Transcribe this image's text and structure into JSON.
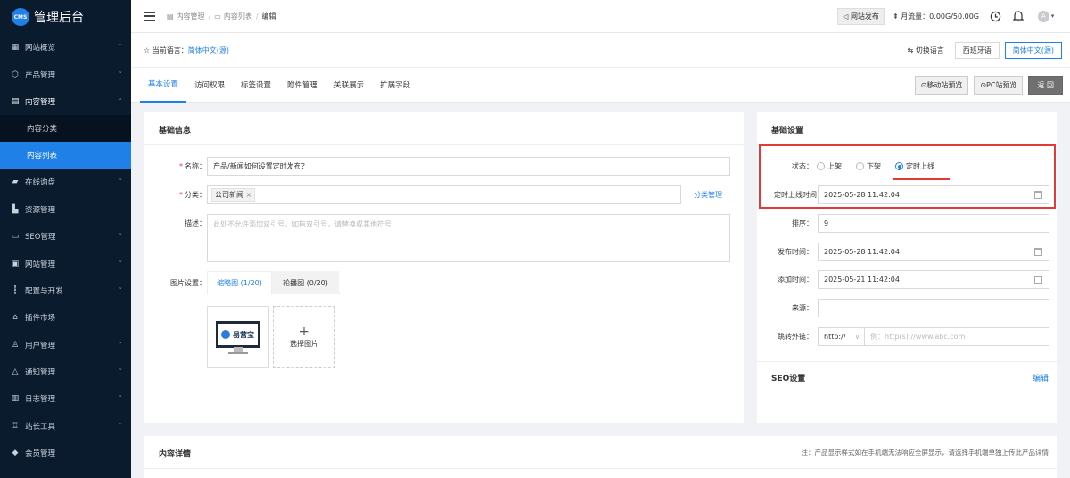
{
  "app": {
    "logo_badge": "CMS",
    "title": "管理后台"
  },
  "sidebar": {
    "items": [
      {
        "label": "网站概览",
        "icon": "dashboard-icon",
        "has_arrow": true
      },
      {
        "label": "产品管理",
        "icon": "box-icon",
        "has_arrow": true
      },
      {
        "label": "内容管理",
        "icon": "document-icon",
        "has_arrow": true,
        "open": true
      },
      {
        "label": "在线询盘",
        "icon": "chat-icon",
        "has_arrow": true
      },
      {
        "label": "资源管理",
        "icon": "folder-icon",
        "has_arrow": false
      },
      {
        "label": "SEO管理",
        "icon": "monitor-icon",
        "has_arrow": true
      },
      {
        "label": "网站管理",
        "icon": "site-icon",
        "has_arrow": true
      },
      {
        "label": "配置与开发",
        "icon": "sliders-icon",
        "has_arrow": true
      },
      {
        "label": "插件市场",
        "icon": "plugin-icon",
        "has_arrow": false
      },
      {
        "label": "用户管理",
        "icon": "user-icon",
        "has_arrow": true
      },
      {
        "label": "通知管理",
        "icon": "bell-icon",
        "has_arrow": true
      },
      {
        "label": "日志管理",
        "icon": "log-icon",
        "has_arrow": true
      },
      {
        "label": "站长工具",
        "icon": "tools-icon",
        "has_arrow": true
      },
      {
        "label": "会员管理",
        "icon": "member-icon",
        "has_arrow": false
      }
    ],
    "sub_items": [
      {
        "label": "内容分类",
        "active": false
      },
      {
        "label": "内容列表",
        "active": true
      }
    ]
  },
  "topbar": {
    "breadcrumb": [
      "内容管理",
      "内容列表",
      "编辑"
    ],
    "publish_label": "网站发布",
    "flow_label": "月流量：0.00G/50.00G",
    "avatar_letter": "A"
  },
  "lang_bar": {
    "current_label": "当前语言：",
    "current_value": "简体中文(源)",
    "switch_label": "切换语言",
    "languages": [
      "西班牙语",
      "简体中文(源)"
    ]
  },
  "tabs": [
    "基本设置",
    "访问权限",
    "标签设置",
    "附件管理",
    "关联展示",
    "扩展字段"
  ],
  "tab_actions": {
    "mobile_preview": "⊙移动站预览",
    "pc_preview": "⊙PC站预览",
    "back": "返 回"
  },
  "basic_info": {
    "title": "基础信息",
    "name_label": "名称：",
    "name_value": "产品/新闻如何设置定时发布？",
    "category_label": "分类：",
    "category_tag": "公司新闻",
    "category_manage": "分类管理",
    "desc_label": "描述：",
    "desc_placeholder": "此处不允许添加双引号，如有双引号，请替换成其他符号",
    "image_label": "图片设置：",
    "image_tabs": [
      "缩略图 (1/20)",
      "轮播图 (0/20)"
    ],
    "thumb_brand": "易营宝",
    "select_image": "选择图片",
    "plus": "+"
  },
  "basic_settings": {
    "title": "基础设置",
    "status_label": "状态：",
    "status_options": [
      "上架",
      "下架",
      "定时上线"
    ],
    "status_selected": "定时上线",
    "schedule_label": "定时上线时间",
    "schedule_value": "2025-05-28 11:42:04",
    "sort_label": "排序：",
    "sort_value": "9",
    "publish_time_label": "发布时间：",
    "publish_time_value": "2025-05-28 11:42:04",
    "add_time_label": "添加时间：",
    "add_time_value": "2025-05-21 11:42:04",
    "source_label": "来源：",
    "source_value": "",
    "jump_label": "跳转外链：",
    "jump_protocol": "http://",
    "jump_placeholder": "例：http(s)://www.abc.com"
  },
  "seo": {
    "title": "SEO设置",
    "edit": "编辑"
  },
  "content_detail": {
    "title": "内容详情",
    "note": "注：产品显示样式如在手机端无法响应全屏显示，请选择手机端单独上传此产品详情"
  },
  "colors": {
    "accent": "#1f80e8",
    "sidebar_bg": "#0a1b2e",
    "highlight_red": "#e53935"
  }
}
